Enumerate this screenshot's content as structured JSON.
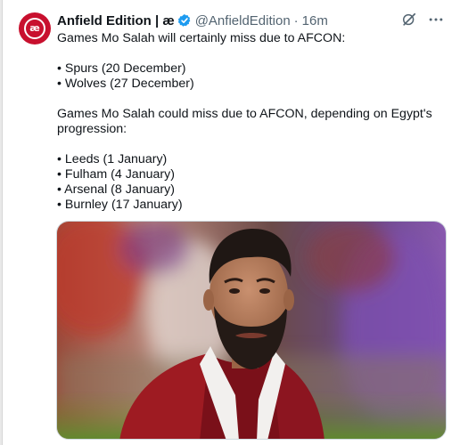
{
  "tweet": {
    "display_name": "Anfield Edition | æ",
    "handle": "@AnfieldEdition",
    "separator": "·",
    "time": "16m",
    "avatar_text": "æ",
    "brand_color": "#c8102e",
    "verified_color": "#1d9bf0",
    "icons": [
      "grok-icon",
      "more-icon",
      "verified-badge-icon"
    ],
    "lines": {
      "l1": "Games Mo Salah will certainly miss due to AFCON:",
      "l2": "• Spurs (20 December)",
      "l3": "• Wolves (27 December)",
      "l4": "Games Mo Salah could miss due to AFCON, depending on Egypt's",
      "l5": "progression:",
      "l6": "• Leeds (1 January)",
      "l7": "• Fulham (4 January)",
      "l8": "• Arsenal (8 January)",
      "l9": "• Burnley (17 January)"
    }
  }
}
